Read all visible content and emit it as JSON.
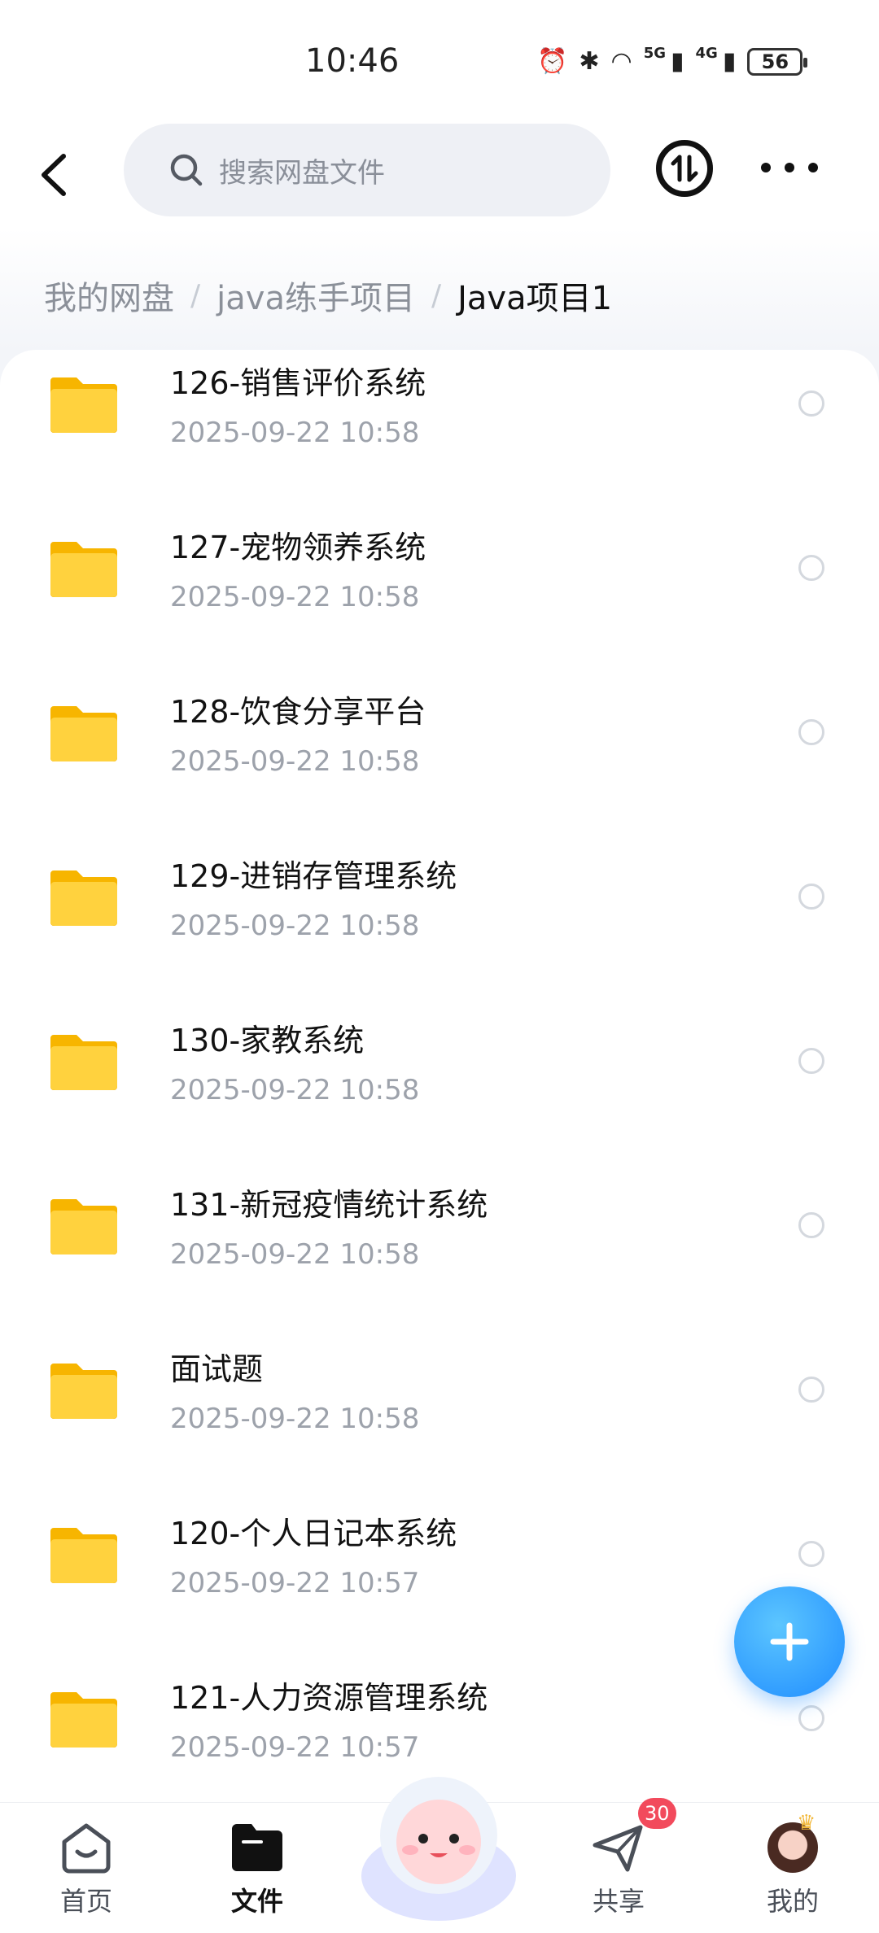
{
  "status_bar": {
    "time": "10:46",
    "network_5g": "5G",
    "network_4g": "4G",
    "battery": "56"
  },
  "search": {
    "placeholder": "搜索网盘文件"
  },
  "breadcrumb": {
    "root": "我的网盘",
    "parent": "java练手项目",
    "current": "Java项目1"
  },
  "files": [
    {
      "name": "126-销售评价系统",
      "date": "2025-09-22  10:58"
    },
    {
      "name": "127-宠物领养系统",
      "date": "2025-09-22  10:58"
    },
    {
      "name": "128-饮食分享平台",
      "date": "2025-09-22  10:58"
    },
    {
      "name": "129-进销存管理系统",
      "date": "2025-09-22  10:58"
    },
    {
      "name": "130-家教系统",
      "date": "2025-09-22  10:58"
    },
    {
      "name": "131-新冠疫情统计系统",
      "date": "2025-09-22  10:58"
    },
    {
      "name": "面试题",
      "date": "2025-09-22  10:58"
    },
    {
      "name": "120-个人日记本系统",
      "date": "2025-09-22  10:57"
    },
    {
      "name": "121-人力资源管理系统",
      "date": "2025-09-22  10:57"
    }
  ],
  "nav": {
    "home": "首页",
    "files": "文件",
    "share": "共享",
    "share_badge": "30",
    "mine": "我的"
  },
  "colors": {
    "accent": "#1f8cff",
    "folder": "#ffcc33",
    "badge": "#f24a5c"
  },
  "icons": {
    "back": "chevron-left-icon",
    "search": "search-icon",
    "transfer": "transfer-icon",
    "more": "more-icon",
    "folder": "folder-icon",
    "add": "plus-icon"
  }
}
